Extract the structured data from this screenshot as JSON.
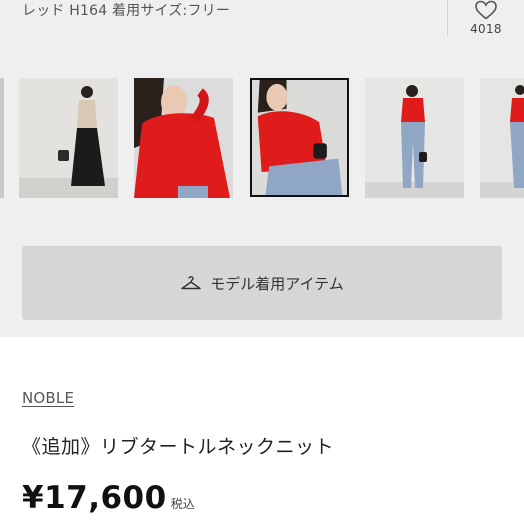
{
  "model_info": "レッド H164 着用サイズ:フリー",
  "favorite": {
    "count": "4018",
    "icon": "heart-icon"
  },
  "thumbnails": [
    {
      "name": "thumbnail-0",
      "selected": false
    },
    {
      "name": "thumbnail-1",
      "selected": false
    },
    {
      "name": "thumbnail-2",
      "selected": false
    },
    {
      "name": "thumbnail-3",
      "selected": true
    },
    {
      "name": "thumbnail-4",
      "selected": false
    },
    {
      "name": "thumbnail-5",
      "selected": false
    }
  ],
  "model_items_button": {
    "label": "モデル着用アイテム",
    "icon": "hanger-icon"
  },
  "product": {
    "brand": "NOBLE",
    "title": "《追加》リブタートルネックニット",
    "price": "¥17,600",
    "tax_label": "税込"
  },
  "colors": {
    "background_gray": "#efefef",
    "button_gray": "#d6d6d6",
    "knit_red": "#e01b1b",
    "denim_blue": "#8fa6c4"
  }
}
